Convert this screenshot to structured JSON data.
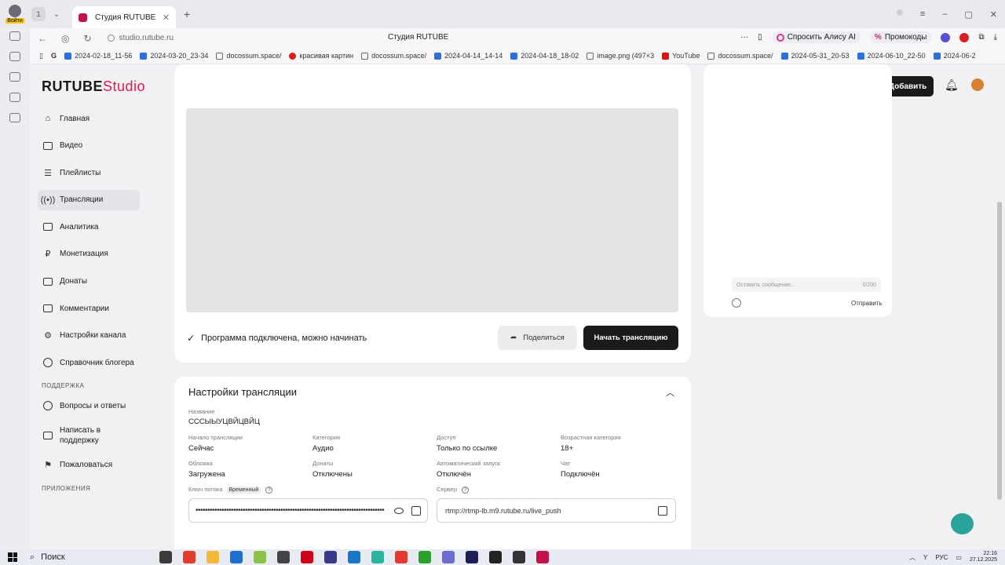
{
  "browser": {
    "profile_label": "Войти",
    "tab_count": "1",
    "tab_title": "Студия RUTUBE",
    "url": "studio.rutube.ru",
    "page_title": "Студия RUTUBE",
    "alice_label": "Спросить Алису AI",
    "promo_label": "Промокоды",
    "bookmarks": [
      "2024-02-18_11-56",
      "2024-03-20_23-34",
      "docossum.space/",
      "красивая картин",
      "docossum.space/",
      "2024-04-14_14-14",
      "2024-04-18_18-02",
      "image.png (497×3",
      "YouTube",
      "docossum.space/",
      "2024-05-31_20-53",
      "2024-06-10_22-50",
      "2024-06-2"
    ]
  },
  "header": {
    "logo_main": "RUTUBE",
    "logo_studio": "Studio",
    "add_button": "Добавить"
  },
  "sidebar": {
    "items": [
      {
        "label": "Главная"
      },
      {
        "label": "Видео"
      },
      {
        "label": "Плейлисты"
      },
      {
        "label": "Трансляции"
      },
      {
        "label": "Аналитика"
      },
      {
        "label": "Монетизация"
      },
      {
        "label": "Донаты"
      },
      {
        "label": "Комментарии"
      },
      {
        "label": "Настройки канала"
      },
      {
        "label": "Справочник блогера"
      }
    ],
    "support_title": "ПОДДЕРЖКА",
    "support_items": [
      {
        "label": "Вопросы и ответы"
      },
      {
        "label": "Написать в поддержку"
      },
      {
        "label": "Пожаловаться"
      }
    ],
    "apps_title": "ПРИЛОЖЕНИЯ"
  },
  "stream": {
    "status_text": "Программа подключена, можно начинать",
    "share_button": "Поделиться",
    "start_button": "Начать трансляцию"
  },
  "chat": {
    "placeholder": "Оставить сообщение...",
    "counter": "0/200",
    "send_button": "Отправить"
  },
  "settings": {
    "title": "Настройки трансляции",
    "name_label": "Название",
    "name_value": "СССЫЫУЦВЙЦВЙЦ",
    "start_label": "Начало трансляции",
    "start_value": "Сейчас",
    "category_label": "Категория",
    "category_value": "Аудио",
    "access_label": "Доступ",
    "access_value": "Только по ссылке",
    "age_label": "Возрастная категория",
    "age_value": "18+",
    "cover_label": "Обложка",
    "cover_value": "Загружена",
    "donates_label": "Донаты",
    "donates_value": "Отключены",
    "autostart_label": "Автоматический запуск",
    "autostart_value": "Отключён",
    "chat_label": "Чат",
    "chat_value": "Подключён",
    "key_label": "Ключ потока",
    "key_badge": "Временный",
    "key_value": "••••••••••••••••••••••••••••••••••••••••••••••••••••••••••••••••••••••••••••••••",
    "server_label": "Сервер",
    "server_value": "rtmp://rtmp-lb.m9.rutube.ru/live_push"
  },
  "taskbar": {
    "search_label": "Поиск",
    "lang": "РУС",
    "time": "22:16",
    "date": "27.12.2025"
  },
  "colors": {
    "accent": "#e6164b",
    "dark_button": "#1a1a1a",
    "help_button": "#2aa39a"
  }
}
